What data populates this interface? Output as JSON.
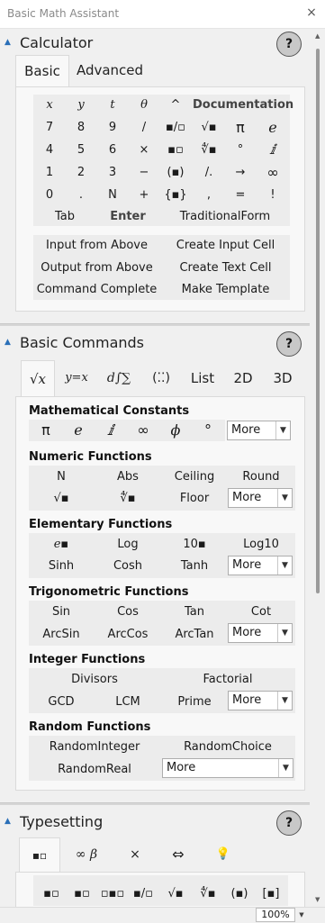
{
  "window": {
    "title": "Basic Math Assistant",
    "close_glyph": "×",
    "zoom": "100%"
  },
  "help_glyph": "?",
  "more_label": "More",
  "calculator": {
    "title": "Calculator",
    "tabs": [
      "Basic",
      "Advanced"
    ],
    "keys": [
      [
        "x",
        "y",
        "t",
        "θ",
        "^",
        "Documentation"
      ],
      [
        "7",
        "8",
        "9",
        "/",
        "▪/▫",
        "√▪",
        "π",
        "e"
      ],
      [
        "4",
        "5",
        "6",
        "×",
        "▪▫",
        "∜▪",
        "°",
        "ⅈ"
      ],
      [
        "1",
        "2",
        "3",
        "−",
        "(▪)",
        "/.",
        "→",
        "∞"
      ],
      [
        "0",
        ".",
        "N",
        "+",
        "{▪}",
        ",",
        "=",
        "!"
      ],
      [
        "Tab",
        "Enter",
        "TraditionalForm"
      ]
    ],
    "actions": [
      [
        "Input from Above",
        "Create Input Cell"
      ],
      [
        "Output from Above",
        "Create Text Cell"
      ],
      [
        "Command Complete",
        "Make Template"
      ]
    ]
  },
  "basic_commands": {
    "title": "Basic Commands",
    "tabs": [
      "√x",
      "y=x",
      "d∫∑",
      "(⁚⁚)",
      "List",
      "2D",
      "3D"
    ],
    "groups": [
      {
        "title": "Mathematical Constants",
        "rows": [
          [
            "π",
            "e",
            "ⅈ",
            "∞",
            "ϕ",
            "°"
          ]
        ]
      },
      {
        "title": "Numeric Functions",
        "rows": [
          [
            "N",
            "Abs",
            "Ceiling",
            "Round"
          ],
          [
            "√▪",
            "∜▪",
            "Floor"
          ]
        ]
      },
      {
        "title": "Elementary Functions",
        "rows": [
          [
            "e▪",
            "Log",
            "10▪",
            "Log10"
          ],
          [
            "Sinh",
            "Cosh",
            "Tanh"
          ]
        ]
      },
      {
        "title": "Trigonometric Functions",
        "rows": [
          [
            "Sin",
            "Cos",
            "Tan",
            "Cot"
          ],
          [
            "ArcSin",
            "ArcCos",
            "ArcTan"
          ]
        ]
      },
      {
        "title": "Integer Functions",
        "rows": [
          [
            "Divisors",
            "Factorial"
          ],
          [
            "GCD",
            "LCM",
            "Prime"
          ]
        ]
      },
      {
        "title": "Random Functions",
        "rows": [
          [
            "RandomInteger",
            "RandomChoice"
          ],
          [
            "RandomReal"
          ]
        ]
      }
    ]
  },
  "typesetting": {
    "title": "Typesetting",
    "tabs": [
      "▪▫",
      "∞ β",
      "×",
      "⇔",
      "💡"
    ],
    "keys": [
      "▪▫",
      "▪▫",
      "▫▪▫",
      "▪/▫",
      "√▪",
      "∜▪",
      "(▪)",
      "[▪]"
    ]
  },
  "colors": {
    "accent": "#2a6fb8",
    "panel": "#f8f8f8",
    "window": "#f0f0f0"
  }
}
